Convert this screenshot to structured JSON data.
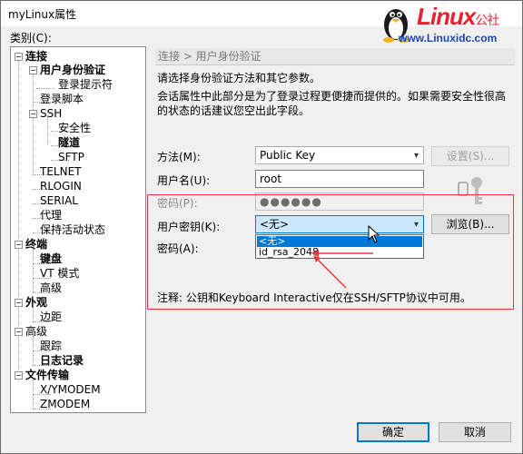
{
  "window": {
    "title": "myLinux属性"
  },
  "watermark": {
    "brand": "Linux",
    "brand_suffix": "公社",
    "url": "www.Linuxidc.com"
  },
  "category_label": "类别(C):",
  "tree": {
    "connection": "连接",
    "auth": "用户身份验证",
    "login_prompts": "登录提示符",
    "login_script": "登录脚本",
    "ssh": "SSH",
    "security": "安全性",
    "tunnel": "隧道",
    "sftp": "SFTP",
    "telnet": "TELNET",
    "rlogin": "RLOGIN",
    "serial": "SERIAL",
    "proxy": "代理",
    "keepalive": "保持活动状态",
    "terminal": "终端",
    "keyboard": "键盘",
    "vt_modes": "VT 模式",
    "advanced": "高级",
    "appearance": "外观",
    "margin": "边距",
    "advanced2": "高级",
    "tracing": "跟踪",
    "logging": "日志记录",
    "file_transfer": "文件传输",
    "xymodem": "X/YMODEM",
    "zmodem": "ZMODEM"
  },
  "panel": {
    "breadcrumb": "连接 > 用户身份验证",
    "desc1": "请选择身份验证方法和其它参数。",
    "desc2": "会话属性中此部分是为了登录过程更便捷而提供的。如果需要安全性很高",
    "desc3": "的状态的话建议您空出此字段。",
    "method_label": "方法(M):",
    "method_value": "Public Key",
    "settings_button": "设置(S)...",
    "username_label": "用户名(U):",
    "username_value": "root",
    "password_label": "密码(P):",
    "password_value": "●●●●●●",
    "userkey_label": "用户密钥(K):",
    "userkey_value": "<无>",
    "browse_button": "浏览(B)...",
    "passphrase_label": "密码(A):",
    "dropdown_options": [
      "<无>",
      "id_rsa_2048"
    ],
    "note": "注释: 公钥和Keyboard Interactive仅在SSH/SFTP协议中可用。"
  },
  "buttons": {
    "ok": "确定",
    "cancel": "取消"
  },
  "colors": {
    "accent": "#0078d7",
    "highlight": "#e5393d",
    "brand_red": "#e8212e",
    "brand_blue": "#1a46b0"
  }
}
